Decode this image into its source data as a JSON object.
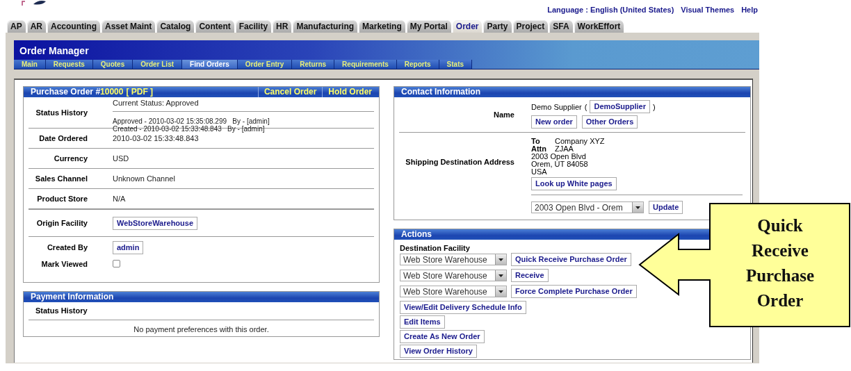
{
  "header_links": [
    {
      "label": "Language : English (United States)"
    },
    {
      "label": "Visual Themes"
    },
    {
      "label": "Help"
    }
  ],
  "app_tabs": [
    {
      "label": "AP",
      "selected": false
    },
    {
      "label": "AR",
      "selected": false
    },
    {
      "label": "Accounting",
      "selected": false
    },
    {
      "label": "Asset Maint",
      "selected": false
    },
    {
      "label": "Catalog",
      "selected": false
    },
    {
      "label": "Content",
      "selected": false
    },
    {
      "label": "Facility",
      "selected": false
    },
    {
      "label": "HR",
      "selected": false
    },
    {
      "label": "Manufacturing",
      "selected": false
    },
    {
      "label": "Marketing",
      "selected": false
    },
    {
      "label": "My Portal",
      "selected": false
    },
    {
      "label": "Order",
      "selected": true
    },
    {
      "label": "Party",
      "selected": false
    },
    {
      "label": "Project",
      "selected": false
    },
    {
      "label": "SFA",
      "selected": false
    },
    {
      "label": "WorkEffort",
      "selected": false
    }
  ],
  "app_header": {
    "title": "Order Manager",
    "menu": [
      {
        "label": "Main",
        "selected": false
      },
      {
        "label": "Requests",
        "selected": false
      },
      {
        "label": "Quotes",
        "selected": false
      },
      {
        "label": "Order List",
        "selected": false
      },
      {
        "label": "Find Orders",
        "selected": true
      },
      {
        "label": "Order Entry",
        "selected": false
      },
      {
        "label": "Returns",
        "selected": false
      },
      {
        "label": "Requirements",
        "selected": false
      },
      {
        "label": "Reports",
        "selected": false
      },
      {
        "label": "Stats",
        "selected": false
      }
    ]
  },
  "order_panel": {
    "title": "Purchase Order #",
    "order_number": "10000",
    "pdf_link": "[ PDF ]",
    "actions": [
      "Cancel Order",
      "Hold Order"
    ],
    "rows": [
      {
        "kind": "status",
        "label": "Status History",
        "current": "Current Status: Approved",
        "history": [
          "Approved - 2010-03-02 15:35:08.299   By - [admin]",
          "Created - 2010-03-02 15:33:48.843   By - [admin]"
        ]
      },
      {
        "kind": "text",
        "label": "Date Ordered",
        "value": "2010-03-02 15:33:48.843"
      },
      {
        "kind": "text",
        "label": "Currency",
        "value": "USD"
      },
      {
        "kind": "text",
        "label": "Sales Channel",
        "value": "Unknown Channel"
      },
      {
        "kind": "text",
        "label": "Product Store",
        "value": "N/A"
      },
      {
        "kind": "link",
        "label": "Origin Facility",
        "value": "WebStoreWarehouse"
      },
      {
        "kind": "link",
        "label": "Created By",
        "value": "admin"
      },
      {
        "kind": "checkbox",
        "label": "Mark Viewed",
        "checked": false
      }
    ]
  },
  "payment_panel": {
    "title": "Payment Information",
    "label": "Status History",
    "message": "No payment preferences with this order."
  },
  "contact_panel": {
    "title": "Contact Information",
    "name_row": {
      "label": "Name",
      "name": "Demo Supplier",
      "open_paren": "(",
      "party_link": "DemoSupplier",
      "close_paren": ")",
      "buttons": [
        "New order",
        "Other Orders"
      ]
    },
    "shipping_row": {
      "label": "Shipping Destination Address",
      "address": [
        {
          "kind": "labeled",
          "label": "To",
          "value": "Company XYZ"
        },
        {
          "kind": "labeled",
          "label": "Attn",
          "value": "ZJAA"
        },
        {
          "kind": "line",
          "value": "2003 Open Blvd"
        },
        {
          "kind": "line",
          "value": "Orem, UT 84058"
        },
        {
          "kind": "line",
          "value": "USA"
        }
      ],
      "lookup_button": "Look up White pages",
      "address_select": "2003 Open Blvd - Orem",
      "update_button": "Update"
    }
  },
  "actions_panel": {
    "title": "Actions",
    "facility_label": "Destination Facility",
    "facility_rows": [
      {
        "select": "Web Store Warehouse",
        "button": "Quick Receive Purchase Order"
      },
      {
        "select": "Web Store Warehouse",
        "button": "Receive"
      },
      {
        "select": "Web Store Warehouse",
        "button": "Force Complete Purchase Order"
      }
    ],
    "buttons": [
      "View/Edit Delivery Schedule Info",
      "Edit Items",
      "Create As New Order",
      "View Order History"
    ]
  },
  "callout": {
    "text": "Quick Receive Purchase Order"
  }
}
